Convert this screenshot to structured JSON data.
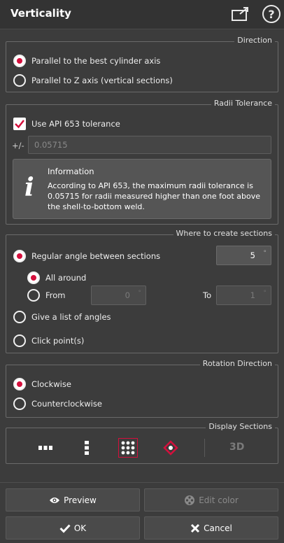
{
  "title": "Verticality",
  "icons": {
    "popout": "popout-window-icon",
    "help": "help-icon",
    "info": "info-icon",
    "preview": "eye-icon",
    "edit_color": "color-palette-icon",
    "ok": "checkmark-icon",
    "cancel": "close-icon"
  },
  "colors": {
    "accent": "#d40f3c",
    "background": "#3c3c3c"
  },
  "direction": {
    "title": "Direction",
    "options": [
      {
        "label": "Parallel to the best cylinder axis",
        "selected": true
      },
      {
        "label": "Parallel to Z axis (vertical sections)",
        "selected": false
      }
    ]
  },
  "radii": {
    "title": "Radii Tolerance",
    "use_api_label": "Use API 653 tolerance",
    "use_api_checked": true,
    "plusminus_label": "+/-",
    "tolerance_value": "0.05715",
    "info_title": "Information",
    "info_text": "According to API 653, the maximum radii tolerance is 0.05715 for radii measured higher than one foot above the shell-to-bottom weld."
  },
  "where": {
    "title": "Where to create sections",
    "regular_label": "Regular angle between sections",
    "regular_selected": true,
    "angle_value": "5",
    "degree_symbol": "°",
    "all_around_label": "All around",
    "all_around_selected": true,
    "from_label": "From",
    "from_value": "0",
    "to_label": "To",
    "to_value": "1",
    "list_label": "Give a list of angles",
    "click_label": "Click point(s)"
  },
  "rotation": {
    "title": "Rotation Direction",
    "options": [
      {
        "label": "Clockwise",
        "selected": true
      },
      {
        "label": "Counterclockwise",
        "selected": false
      }
    ]
  },
  "display": {
    "title": "Display Sections",
    "buttons": [
      {
        "name": "horizontal-dots-icon"
      },
      {
        "name": "vertical-dots-icon"
      },
      {
        "name": "grid-dots-icon",
        "active": true
      },
      {
        "name": "diamond-point-icon"
      }
    ],
    "label_3d": "3D"
  },
  "footer": {
    "preview_label": "Preview",
    "edit_color_label": "Edit color",
    "ok_label": "OK",
    "cancel_label": "Cancel"
  }
}
